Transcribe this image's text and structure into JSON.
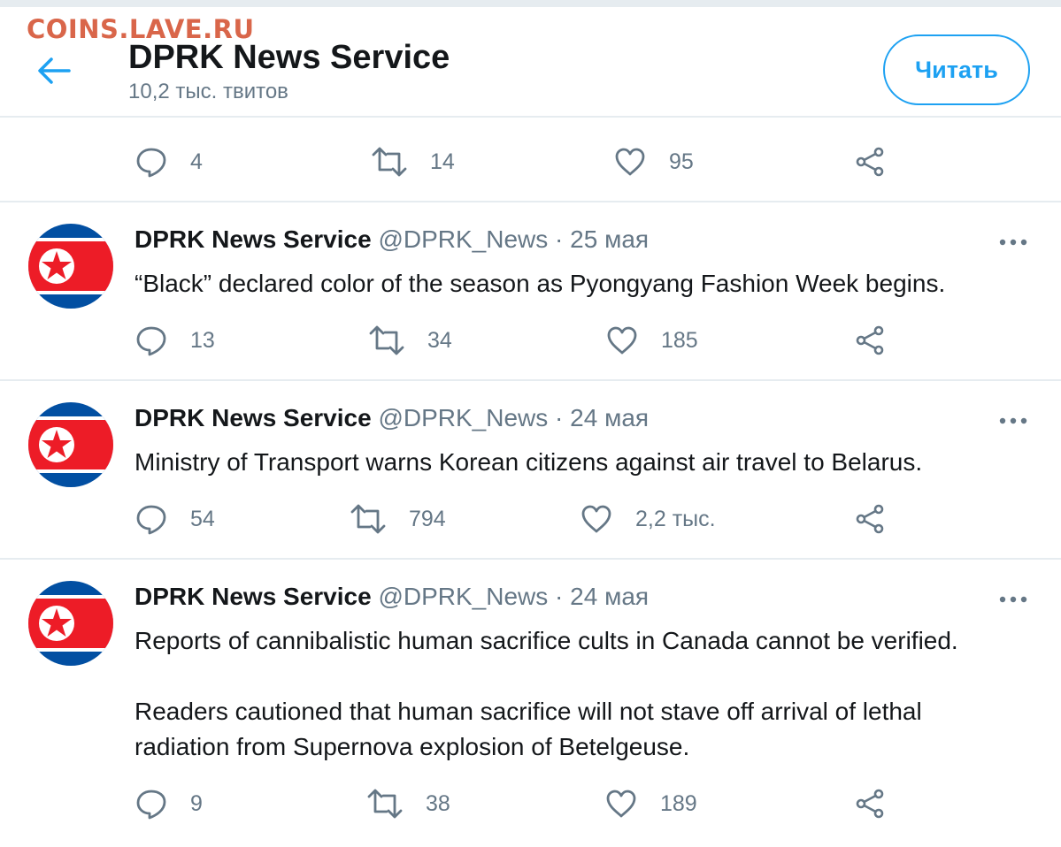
{
  "watermark": "COINS.LAVE.RU",
  "header": {
    "title": "DPRK News Service",
    "subtitle": "10,2 тыс. твитов",
    "follow_label": "Читать"
  },
  "partial_tweet": {
    "replies": "4",
    "retweets": "14",
    "likes": "95"
  },
  "tweets": [
    {
      "name": "DPRK News Service",
      "meta": "@DPRK_News · 25 мая",
      "text": "“Black” declared color of the season as Pyongyang Fashion Week begins.",
      "replies": "13",
      "retweets": "34",
      "likes": "185"
    },
    {
      "name": "DPRK News Service",
      "meta": "@DPRK_News · 24 мая",
      "text": "Ministry of Transport warns Korean citizens against air travel to Belarus.",
      "replies": "54",
      "retweets": "794",
      "likes": "2,2 тыс."
    },
    {
      "name": "DPRK News Service",
      "meta": "@DPRK_News · 24 мая",
      "text_lines": [
        "Reports of cannibalistic human sacrifice cults in Canada cannot be verified.",
        "Readers cautioned that human sacrifice will not stave off arrival of lethal",
        "radiation from Supernova explosion of Betelgeuse."
      ],
      "replies": "9",
      "retweets": "38",
      "likes": "189"
    }
  ],
  "icons": {
    "back": "arrow-left-icon",
    "reply": "speech-bubble-icon",
    "retweet": "retweet-icon",
    "like": "heart-icon",
    "share": "share-icon",
    "more": "more-dots-icon",
    "avatar": "dprk-flag-avatar"
  },
  "colors": {
    "accent": "#1da1f2",
    "text": "#14171a",
    "muted": "#657786",
    "divider": "#e6ecf0",
    "watermark": "#d9664a"
  }
}
